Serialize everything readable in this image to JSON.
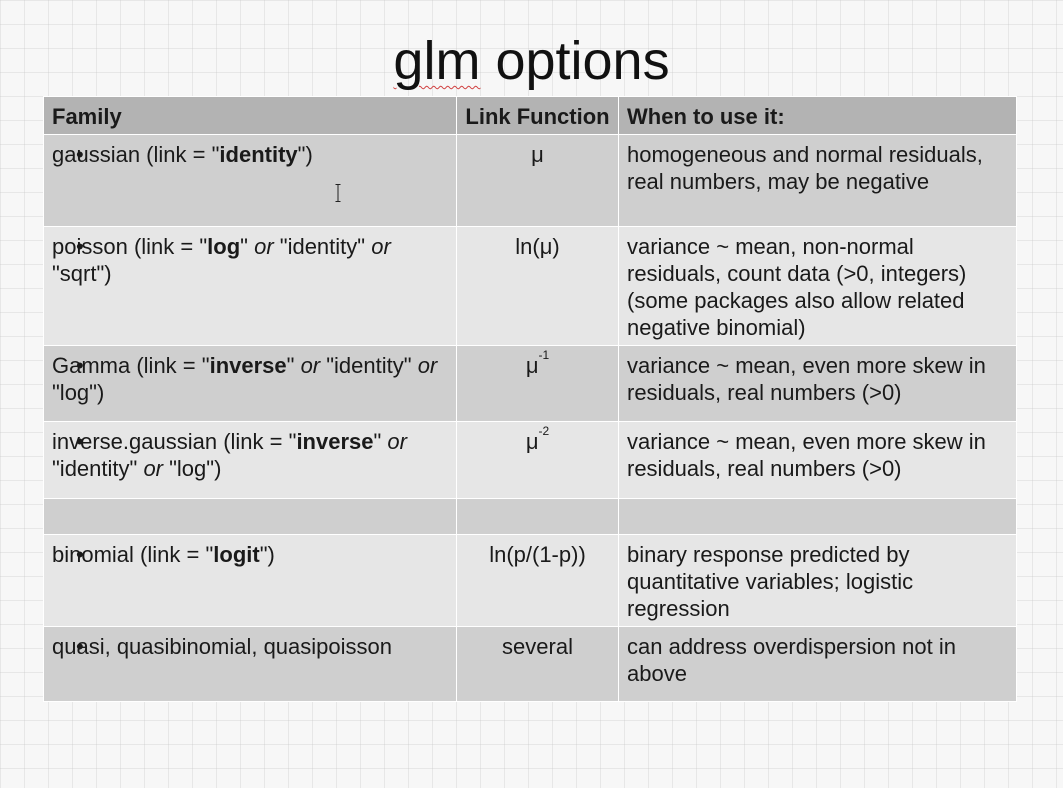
{
  "slide": {
    "title_pre": "glm",
    "title_post": " options"
  },
  "table": {
    "headers": {
      "family": "Family",
      "link": "Link Function",
      "when": "When to use it:"
    },
    "rows": [
      {
        "fam": {
          "a": "gaussian (link = \"",
          "b": "identity",
          "c": "\")"
        },
        "link": "μ",
        "when": "homogeneous and normal residuals, real numbers, may be negative"
      },
      {
        "fam": {
          "a": "poisson (link = \"",
          "b": "log",
          "c": "\" ",
          "d": "or",
          "e": " \"identity\" ",
          "f": "or",
          "g": " \"sqrt\")"
        },
        "link": "ln(μ)",
        "when": "variance ~ mean, non-normal residuals, count data (>0, integers) (some packages also allow related  negative binomial)"
      },
      {
        "fam": {
          "a": "Gamma  (link = \"",
          "b": "inverse",
          "c": "\" ",
          "d": "or",
          "e": " \"identity\" ",
          "f": "or",
          "g": " \"log\")"
        },
        "link_base": "μ",
        "link_sup": "-1",
        "when": "variance ~ mean, even more skew in residuals, real numbers (>0)"
      },
      {
        "fam": {
          "a": "inverse.gaussian  (link = \"",
          "b": "inverse",
          "c": "\" ",
          "d": "or",
          "e": " \"identity\" ",
          "f": "or",
          "g": " \"log\")"
        },
        "link_base": "μ",
        "link_sup": "-2",
        "when": "variance ~ mean, even more skew in residuals, real numbers (>0)"
      },
      {
        "fam": {
          "a": "binomial (link = \"",
          "b": "logit",
          "c": "\")"
        },
        "link": "ln(p/(1-p))",
        "when": "binary response predicted by quantitative variables; logistic regression"
      },
      {
        "fam": {
          "a": "quasi, quasibinomial, quasipoisson"
        },
        "link": "several",
        "when": "can address overdispersion not in above"
      }
    ]
  }
}
